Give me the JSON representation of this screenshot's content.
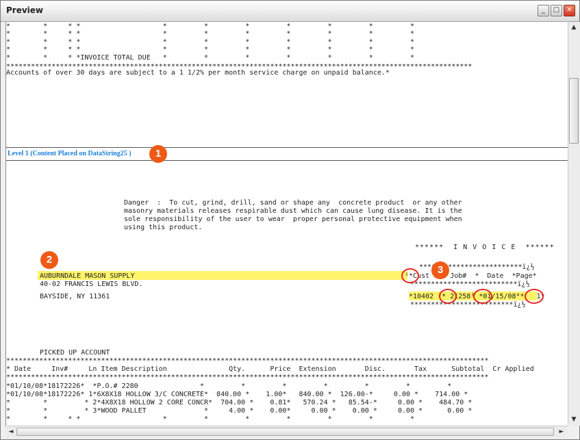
{
  "window": {
    "title": "Preview",
    "minimize": "_",
    "maximize": "□",
    "close": "✕"
  },
  "top_section": {
    "rows": [
      "*        *     * *                    *         *         *         *         *         *         *",
      "*        *     * *                    *         *         *         *         *         *         *",
      "*        *     * *                    *         *         *         *         *         *         *",
      "*        *     * *                    *         *         *         *         *         *         *",
      "*        *     * *INVOICE TOTAL DUE   *         *         *         *         *         *         *"
    ],
    "star_rule": "*****************************************************************************************************************",
    "service_note": "Accounts of over 30 days are subject to a 1 1/2% per month service charge on unpaid balance.*"
  },
  "level_banner": "Level 1 (Content Placed on DataString25 )",
  "callouts": {
    "one": "1",
    "two": "2",
    "three": "3"
  },
  "danger_text": [
    "Danger  :  To cut, grind, drill, sand or shape any  concrete product  or any other",
    "masonry materials releases respirable dust which can cause lung disease. It is the",
    "sole responsibility of the user to wear  proper personal protective equipment when",
    "using this product."
  ],
  "invoice_heading": "******  I N V O I C E  ******",
  "address": {
    "name": "AUBURNDALE MASON SUPPLY",
    "street": "40-02 FRANCIS LEWIS BLVD.",
    "city": "BAYSIDE, NY 11361"
  },
  "cust_box": {
    "top_rule": "*************************ï¿½",
    "header": "¹*Cust   * Job#  *  Date  *Page*",
    "mid_rule": "**************************ï¿½",
    "values": "*10402 ²* 21258³ *01/15/08⁴*   1*",
    "bottom_rule": "*************************ï¿½"
  },
  "account_type": "PICKED UP ACCOUNT",
  "table": {
    "rule": "*********************************************************************************************************************",
    "header": "* Date     Inv#     Ln Item Description               Qty.      Price  Extension       Disc.       Tax      Subtotal  Cr Applied",
    "rows": [
      "*01/10/08*18172226*  *P.O.# 2280               *         *         *         *         *         *         *",
      "*01/10/08*18172226* 1*6X8X18 HOLLOW 3/C CONCRETE*  840.00 *    1.00*   840.00 *  126.00-*     0.00 *    714.00 *",
      "*        *         * 2*4X8X18 HOLLOW 2 CORE CONCR*  704.00 *    0.81*   570.24 *   85.54-*     0.00 *    484.70 *",
      "*        *         * 3*WOOD PALLET              *     4.00 *    0.00*     0.00 *    0.00 *     0.00 *      0.00 *",
      "*        *     * *                    *         *         *         *         *         *         *"
    ]
  },
  "scroll": {
    "up": "▲",
    "down": "▼",
    "left": "◄",
    "right": "►"
  }
}
